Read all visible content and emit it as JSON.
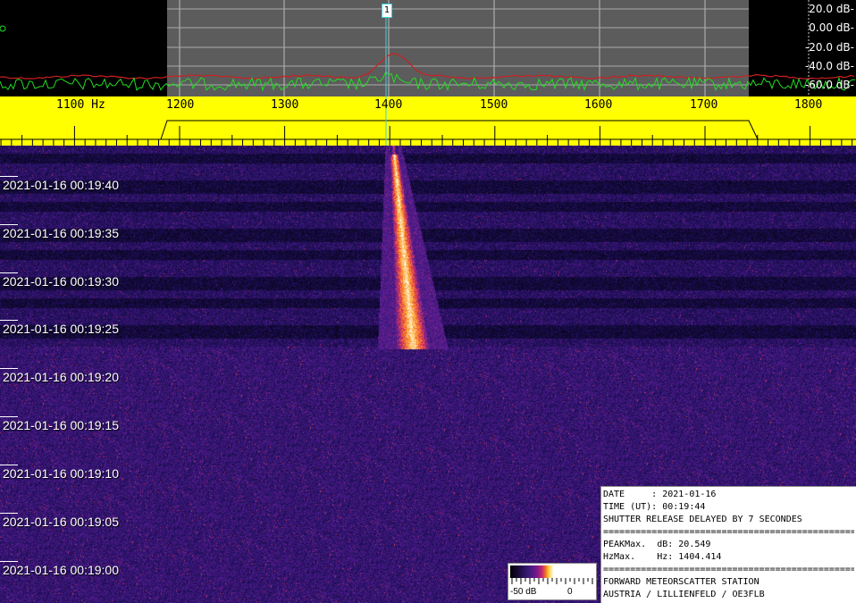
{
  "spectrum": {
    "db_labels": [
      "20.0 dB-",
      "0.00 dB-",
      "-20.0 dB-",
      "-40.0 dB-",
      "-60.0 dB-"
    ],
    "marker_label": "1",
    "colors": {
      "background": "#000000",
      "passband": "#5c5c5c",
      "green_trace": "#22dd22",
      "red_trace": "#cc2020",
      "marker": "#40d0e0"
    }
  },
  "freq_scale": {
    "labels": [
      "1100 Hz",
      "1200",
      "1300",
      "1400",
      "1500",
      "1600",
      "1700",
      "1800"
    ],
    "color": "#ffff00"
  },
  "waterfall": {
    "timestamps": [
      "2021-01-16 00:19:40",
      "2021-01-16 00:19:35",
      "2021-01-16 00:19:30",
      "2021-01-16 00:19:25",
      "2021-01-16 00:19:20",
      "2021-01-16 00:19:15",
      "2021-01-16 00:19:10",
      "2021-01-16 00:19:05",
      "2021-01-16 00:19:00"
    ]
  },
  "info": {
    "date": "DATE     : 2021-01-16",
    "time": "TIME (UT): 00:19:44",
    "shutter": "SHUTTER RELEASE DELAYED BY 7 SECONDES",
    "rule": "=================================================",
    "peak_db": "PEAKMax.  dB: 20.549",
    "peak_hz": "HzMax.    Hz: 1404.414",
    "station": "FORWARD METEORSCATTER STATION",
    "location": "AUSTRIA / LILLIENFELD / OE3FLB"
  },
  "color_legend": {
    "min_label": "-50 dB",
    "max_label": "0"
  }
}
